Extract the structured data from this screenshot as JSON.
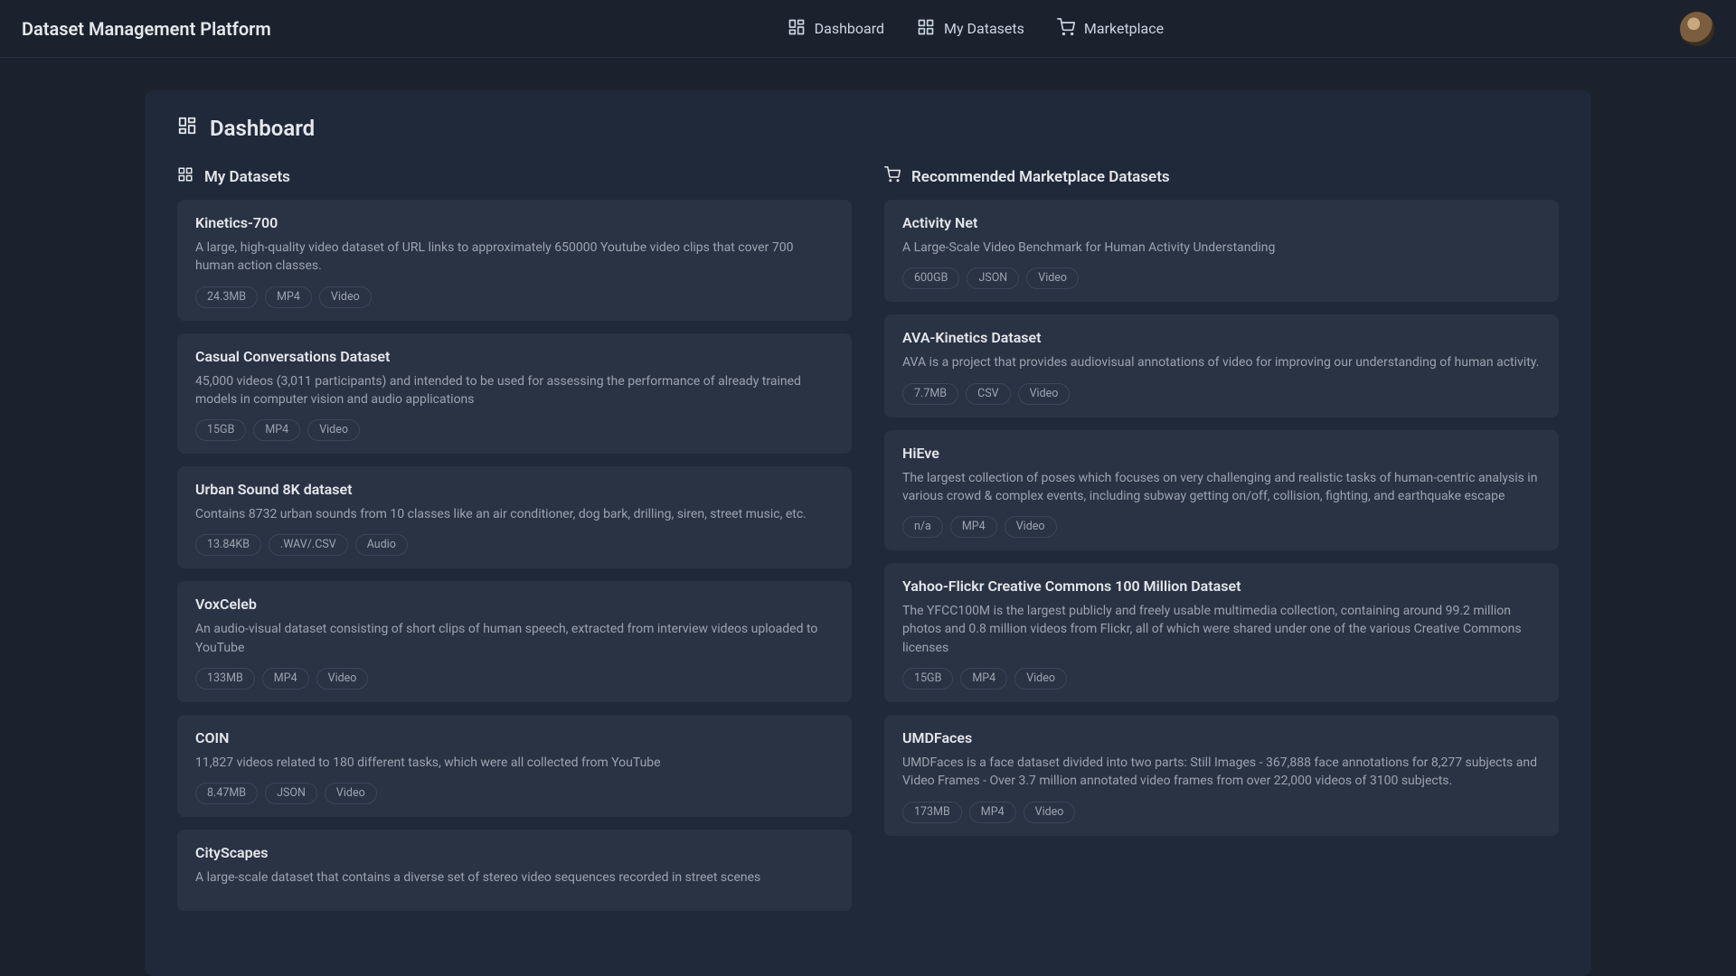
{
  "brand": "Dataset Management Platform",
  "nav": {
    "dashboard": "Dashboard",
    "my_datasets": "My Datasets",
    "marketplace": "Marketplace"
  },
  "page": {
    "title": "Dashboard",
    "left_heading": "My Datasets",
    "right_heading": "Recommended Marketplace Datasets"
  },
  "my_datasets": [
    {
      "title": "Kinetics-700",
      "desc": "A large, high-quality video dataset of URL links to approximately 650000 Youtube video clips that cover 700 human action classes.",
      "tags": [
        "24.3MB",
        "MP4",
        "Video"
      ]
    },
    {
      "title": "Casual Conversations Dataset",
      "desc": "45,000 videos (3,011 participants) and intended to be used for assessing the performance of already trained models in computer vision and audio applications",
      "tags": [
        "15GB",
        "MP4",
        "Video"
      ]
    },
    {
      "title": "Urban Sound 8K dataset",
      "desc": "Contains 8732 urban sounds from 10 classes like an air conditioner, dog bark, drilling, siren, street music, etc.",
      "tags": [
        "13.84KB",
        ".WAV/.CSV",
        "Audio"
      ]
    },
    {
      "title": "VoxCeleb",
      "desc": "An audio-visual dataset consisting of short clips of human speech, extracted from interview videos uploaded to YouTube",
      "tags": [
        "133MB",
        "MP4",
        "Video"
      ]
    },
    {
      "title": "COIN",
      "desc": "11,827 videos related to 180 different tasks, which were all collected from YouTube",
      "tags": [
        "8.47MB",
        "JSON",
        "Video"
      ]
    },
    {
      "title": "CityScapes",
      "desc": "A large-scale dataset that contains a diverse set of stereo video sequences recorded in street scenes",
      "tags": []
    }
  ],
  "recommended": [
    {
      "title": "Activity Net",
      "desc": "A Large-Scale Video Benchmark for Human Activity Understanding",
      "tags": [
        "600GB",
        "JSON",
        "Video"
      ]
    },
    {
      "title": "AVA-Kinetics Dataset",
      "desc": "AVA is a project that provides audiovisual annotations of video for improving our understanding of human activity.",
      "tags": [
        "7.7MB",
        "CSV",
        "Video"
      ]
    },
    {
      "title": "HiEve",
      "desc": "The largest collection of poses which focuses on very challenging and realistic tasks of human-centric analysis in various crowd & complex events, including subway getting on/off, collision, fighting, and earthquake escape",
      "tags": [
        "n/a",
        "MP4",
        "Video"
      ]
    },
    {
      "title": "Yahoo-Flickr Creative Commons 100 Million Dataset",
      "desc": "The YFCC100M is the largest publicly and freely usable multimedia collection, containing around 99.2 million photos and 0.8 million videos from Flickr, all of which were shared under one of the various Creative Commons licenses",
      "tags": [
        "15GB",
        "MP4",
        "Video"
      ]
    },
    {
      "title": "UMDFaces",
      "desc": "UMDFaces is a face dataset divided into two parts: Still Images - 367,888 face annotations for 8,277 subjects and Video Frames - Over 3.7 million annotated video frames from over 22,000 videos of 3100 subjects.",
      "tags": [
        "173MB",
        "MP4",
        "Video"
      ]
    }
  ]
}
